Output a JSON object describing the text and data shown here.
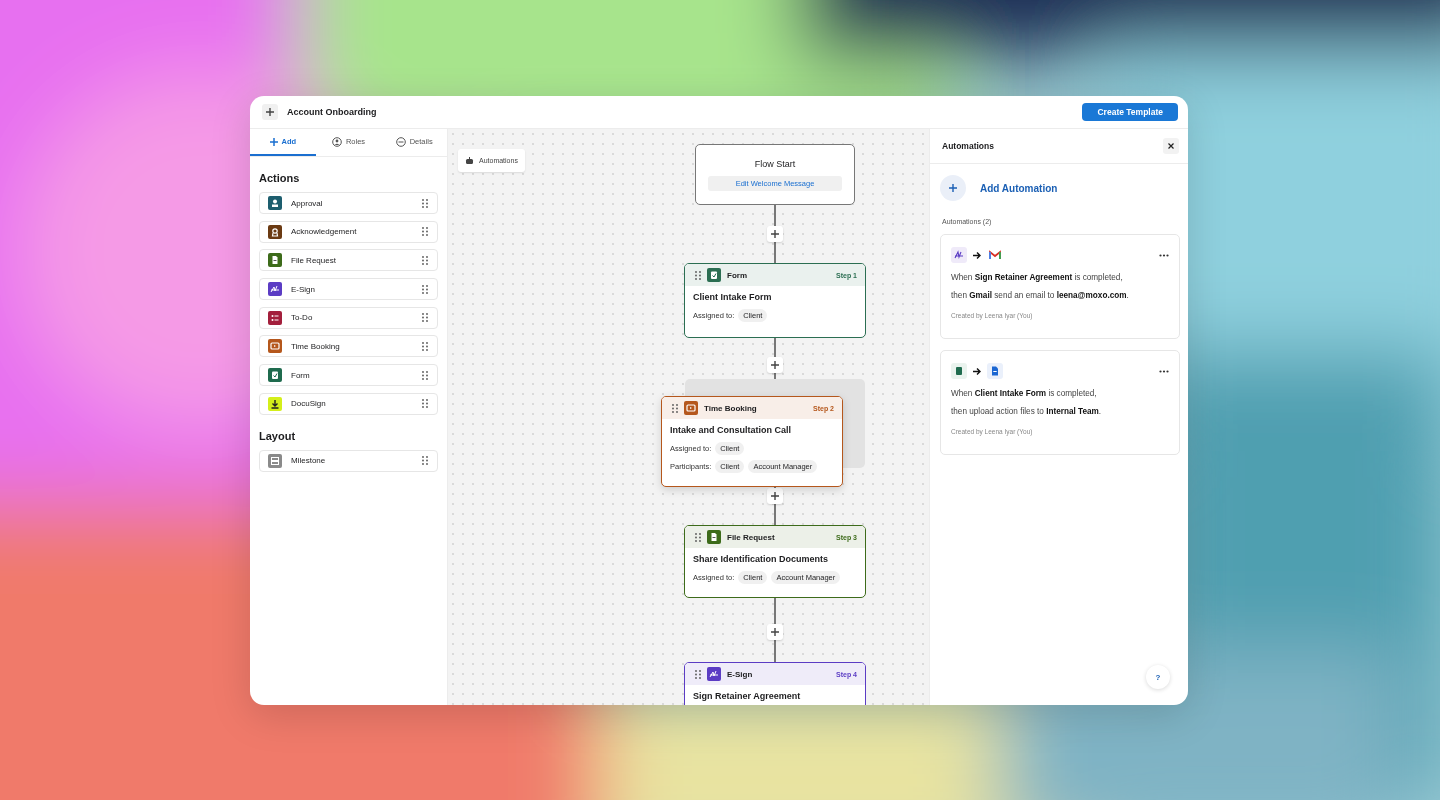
{
  "window": {
    "title": "Account Onboarding",
    "create_button": "Create Template"
  },
  "sidebar": {
    "tabs": [
      {
        "label": "Add",
        "selected": true
      },
      {
        "label": "Roles",
        "selected": false
      },
      {
        "label": "Details",
        "selected": false
      }
    ],
    "sections": [
      {
        "title": "Actions",
        "items": [
          {
            "label": "Approval",
            "kind": "person",
            "color": "#1d5e6e"
          },
          {
            "label": "Acknowledgement",
            "kind": "badge",
            "color": "#6b3a12"
          },
          {
            "label": "File Request",
            "kind": "document",
            "color": "#3d6b1a"
          },
          {
            "label": "E-Sign",
            "kind": "signature",
            "color": "#5b3cc4"
          },
          {
            "label": "To-Do",
            "kind": "list",
            "color": "#a31f3c"
          },
          {
            "label": "Time Booking",
            "kind": "screen",
            "color": "#b5571c"
          },
          {
            "label": "Form",
            "kind": "clipboard",
            "color": "#1f6b4e"
          },
          {
            "label": "DocuSign",
            "kind": "download",
            "color": "#d4ef1a"
          }
        ]
      },
      {
        "title": "Layout",
        "items": [
          {
            "label": "Milestone",
            "kind": "milestone",
            "color": "#8a8a8a"
          }
        ]
      }
    ]
  },
  "canvas": {
    "automations_button": "Automations",
    "start": {
      "title": "Flow Start",
      "link": "Edit Welcome Message"
    },
    "steps": [
      {
        "type": "Form",
        "kind": "clipboard",
        "color": "#2b6e52",
        "step": "Step 1",
        "title": "Client Intake Form",
        "dragging": false,
        "rows": [
          {
            "label": "Assigned to:",
            "chips": [
              "Client"
            ]
          }
        ]
      },
      {
        "type": "Time Booking",
        "kind": "screen",
        "color": "#b5571c",
        "step": "Step 2",
        "title": "Intake and Consultation Call",
        "dragging": true,
        "rows": [
          {
            "label": "Assigned to:",
            "chips": [
              "Client"
            ]
          },
          {
            "label": "Participants:",
            "chips": [
              "Client",
              "Account Manager"
            ]
          }
        ]
      },
      {
        "type": "File Request",
        "kind": "document",
        "color": "#3d6b1a",
        "step": "Step 3",
        "title": "Share Identification Documents",
        "dragging": false,
        "rows": [
          {
            "label": "Assigned to:",
            "chips": [
              "Client",
              "Account Manager"
            ]
          }
        ]
      },
      {
        "type": "E-Sign",
        "kind": "signature",
        "color": "#5b3cc4",
        "step": "Step 4",
        "title": "Sign Retainer Agreement",
        "dragging": false
      }
    ]
  },
  "automations": {
    "title": "Automations",
    "add_label": "Add Automation",
    "count_label": "Automations (2)",
    "cards": [
      {
        "lines": [
          "When **Sign Retainer Agreement** is completed,",
          "then **Gmail** send an email to **leena@moxo.com**."
        ],
        "created": "Created by Leena Iyar (You)"
      },
      {
        "lines": [
          "When **Client Intake Form** is completed,",
          "then upload action files to **Internal Team**."
        ],
        "created": "Created by Leena Iyar (You)"
      }
    ]
  },
  "help": "?"
}
